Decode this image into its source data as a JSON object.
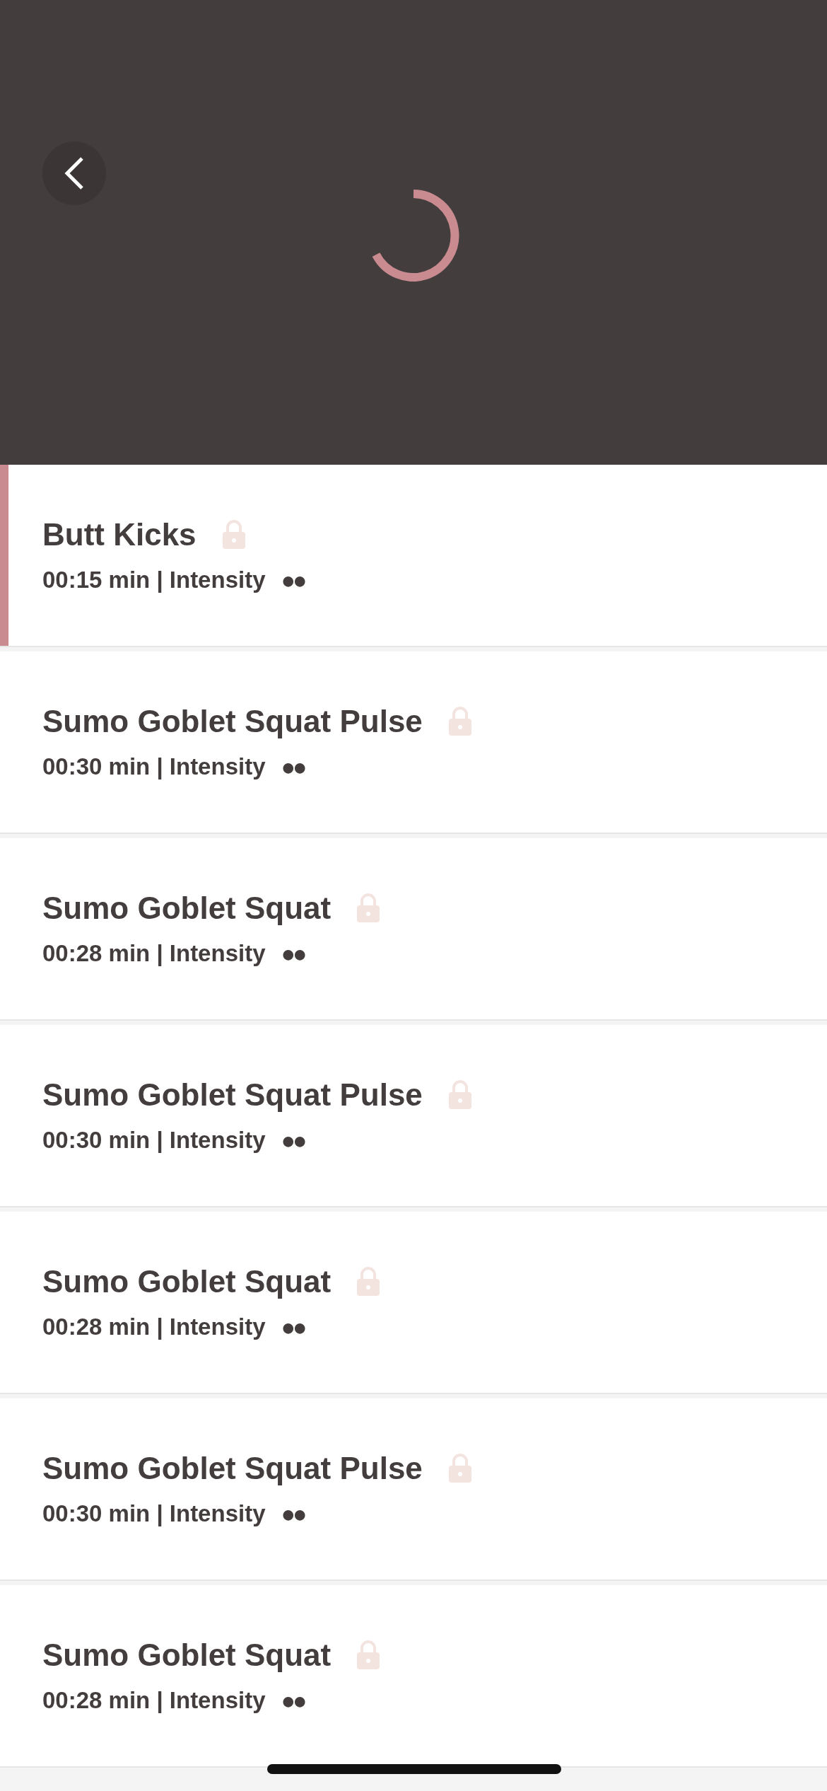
{
  "header": {
    "loading": true
  },
  "exercises": [
    {
      "name": "Butt Kicks",
      "meta": "00:15 min | Intensity",
      "intensity": "●●",
      "locked": true,
      "selected": true
    },
    {
      "name": "Sumo Goblet Squat Pulse",
      "meta": "00:30 min | Intensity",
      "intensity": "●●",
      "locked": true,
      "selected": false
    },
    {
      "name": "Sumo Goblet Squat",
      "meta": "00:28 min | Intensity",
      "intensity": "●●",
      "locked": true,
      "selected": false
    },
    {
      "name": "Sumo Goblet Squat Pulse",
      "meta": "00:30 min | Intensity",
      "intensity": "●●",
      "locked": true,
      "selected": false
    },
    {
      "name": "Sumo Goblet Squat",
      "meta": "00:28 min | Intensity",
      "intensity": "●●",
      "locked": true,
      "selected": false
    },
    {
      "name": "Sumo Goblet Squat Pulse",
      "meta": "00:30 min | Intensity",
      "intensity": "●●",
      "locked": true,
      "selected": false
    },
    {
      "name": "Sumo Goblet Squat",
      "meta": "00:28 min | Intensity",
      "intensity": "●●",
      "locked": true,
      "selected": false
    }
  ]
}
